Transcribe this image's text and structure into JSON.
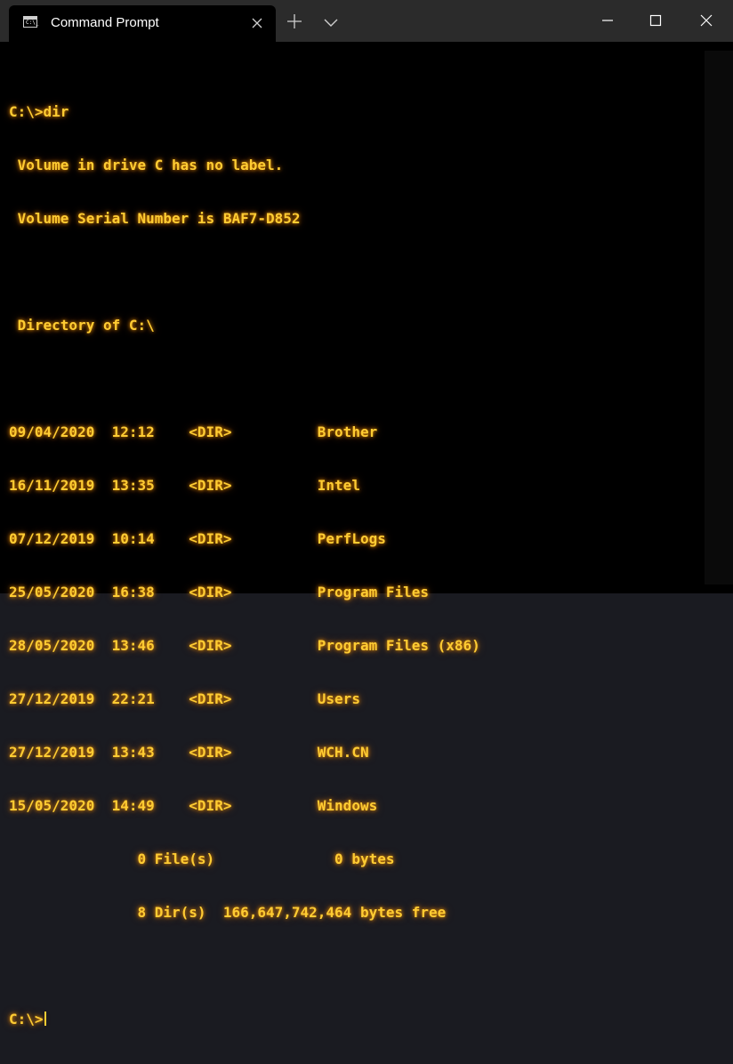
{
  "window": {
    "tab_title": "Command Prompt",
    "tab_icon_text": "C:\\_"
  },
  "colors": {
    "titlebar": "#2b2b2b",
    "terminal_bg": "#000000",
    "text": "#ffcc33",
    "glow": "#ff9900"
  },
  "icons": {
    "tab": "cmd-icon",
    "close_tab": "close-icon",
    "new_tab": "plus-icon",
    "dropdown": "chevron-down-icon",
    "minimize": "minimize-icon",
    "maximize": "maximize-icon",
    "close_window": "close-icon"
  },
  "terminal": {
    "lines": [
      "C:\\>dir",
      " Volume in drive C has no label.",
      " Volume Serial Number is BAF7-D852",
      "",
      " Directory of C:\\",
      "",
      "09/04/2020  12:12    <DIR>          Brother",
      "16/11/2019  13:35    <DIR>          Intel",
      "07/12/2019  10:14    <DIR>          PerfLogs",
      "25/05/2020  16:38    <DIR>          Program Files",
      "28/05/2020  13:46    <DIR>          Program Files (x86)",
      "27/12/2019  22:21    <DIR>          Users",
      "27/12/2019  13:43    <DIR>          WCH.CN",
      "15/05/2020  14:49    <DIR>          Windows",
      "               0 File(s)              0 bytes",
      "               8 Dir(s)  166,647,742,464 bytes free",
      ""
    ],
    "prompt": "C:\\>"
  }
}
